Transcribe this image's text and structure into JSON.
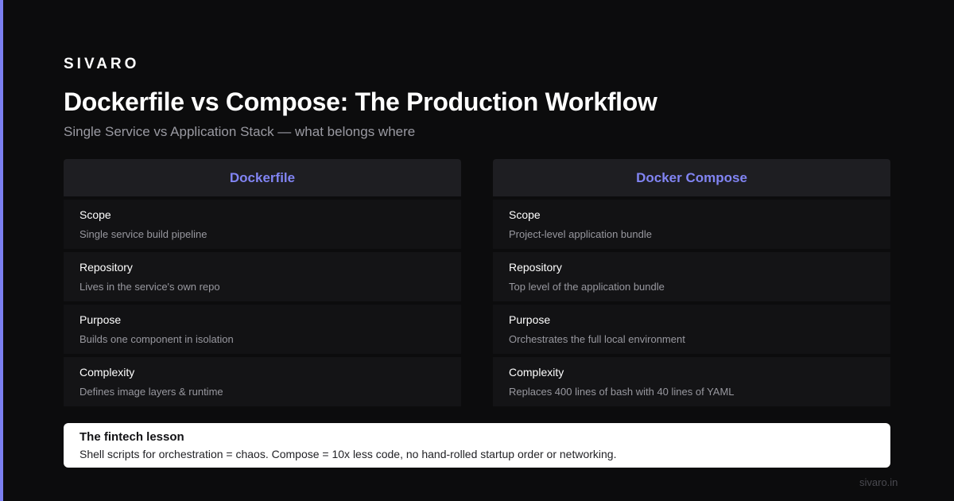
{
  "brand": "SIVARO",
  "title": "Dockerfile vs Compose: The Production Workflow",
  "subtitle": "Single Service vs Application Stack — what belongs where",
  "colors": {
    "accent": "#7b7ff0",
    "header_text": "#8184f3",
    "background": "#0c0c0d"
  },
  "columns": [
    {
      "header": "Dockerfile",
      "rows": [
        {
          "label": "Scope",
          "value": "Single service build pipeline"
        },
        {
          "label": "Repository",
          "value": "Lives in the service's own repo"
        },
        {
          "label": "Purpose",
          "value": "Builds one component in isolation"
        },
        {
          "label": "Complexity",
          "value": "Defines image layers & runtime"
        }
      ]
    },
    {
      "header": "Docker Compose",
      "rows": [
        {
          "label": "Scope",
          "value": "Project-level application bundle"
        },
        {
          "label": "Repository",
          "value": "Top level of the application bundle"
        },
        {
          "label": "Purpose",
          "value": "Orchestrates the full local environment"
        },
        {
          "label": "Complexity",
          "value": "Replaces 400 lines of bash with 40 lines of YAML"
        }
      ]
    }
  ],
  "lesson": {
    "title": "The fintech lesson",
    "text": "Shell scripts for orchestration = chaos. Compose = 10x less code, no hand-rolled startup order or networking."
  },
  "footer": "sivaro.in"
}
